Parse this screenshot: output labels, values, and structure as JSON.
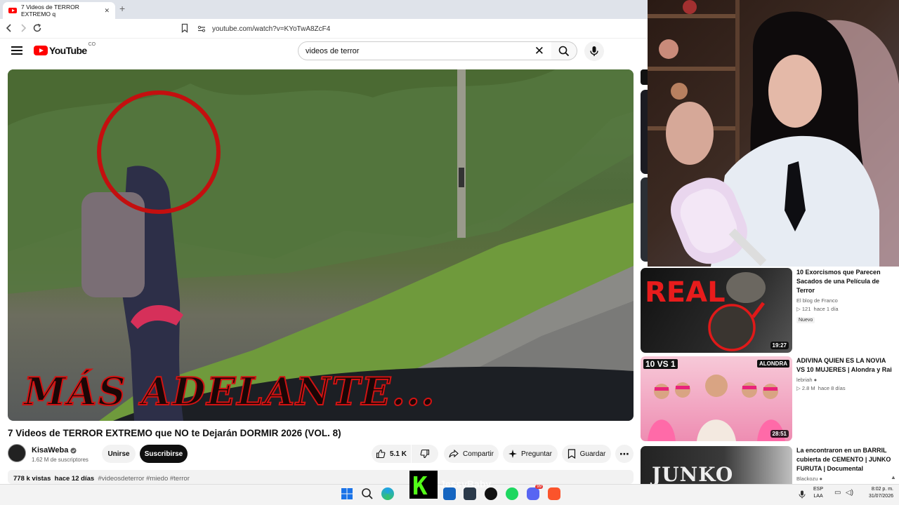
{
  "browser": {
    "tab_title": "7 Videos de TERROR EXTREMO q",
    "url": "youtube.com/watch?v=KYoTwA8ZcF4"
  },
  "youtube": {
    "logo": "YouTube",
    "country_code": "CO",
    "search_value": "videos de  terror"
  },
  "video": {
    "overlay_text": "MÁS ADELANTE...",
    "title": "7 Videos de TERROR EXTREMO que NO te Dejarán DORMIR 2026 (VOL. 8)",
    "channel": "KisaWeba",
    "subscribers": "1.62 M de suscriptores",
    "join_label": "Unirse",
    "subscribe_label": "Suscribirse",
    "likes": "5.1 K",
    "share_label": "Compartir",
    "ask_label": "Preguntar",
    "save_label": "Guardar",
    "views": "778 k vistas",
    "age": "hace 12 días",
    "tags": "#videosdeterror #miedo #terror"
  },
  "recommendations": [
    {
      "title": "10 Exorcismos que Parecen Sacados de una Película de Terror",
      "channel": "El blog de Franco",
      "views": "121",
      "age": "hace 1 día",
      "badge": "Nuevo",
      "duration": "19:27",
      "thumb_text": "REAL"
    },
    {
      "title": "ADIVINA QUIEN ES LA NOVIA VS 10 MUJERES | Alondra y Rai",
      "channel": "lebriah",
      "views": "2.8 M",
      "age": "hace 8 días",
      "duration": "28:51",
      "thumb_text": "10 VS 1",
      "thumb_tag": "ALONDRA"
    },
    {
      "title": "La encontraron en un BARRIL cubierta de CEMENTO | JUNKO FURUTA | Documental",
      "channel": "Blackozu",
      "thumb_text": "JUNKO"
    }
  ],
  "overlay": {
    "watermark": "JessyBaby",
    "k_logo": "K"
  },
  "taskbar": {
    "lang_top": "ESP",
    "lang_bottom": "LAA",
    "time": "8:02 p. m.",
    "date": "31/07/2026",
    "discord_badge": "99"
  }
}
